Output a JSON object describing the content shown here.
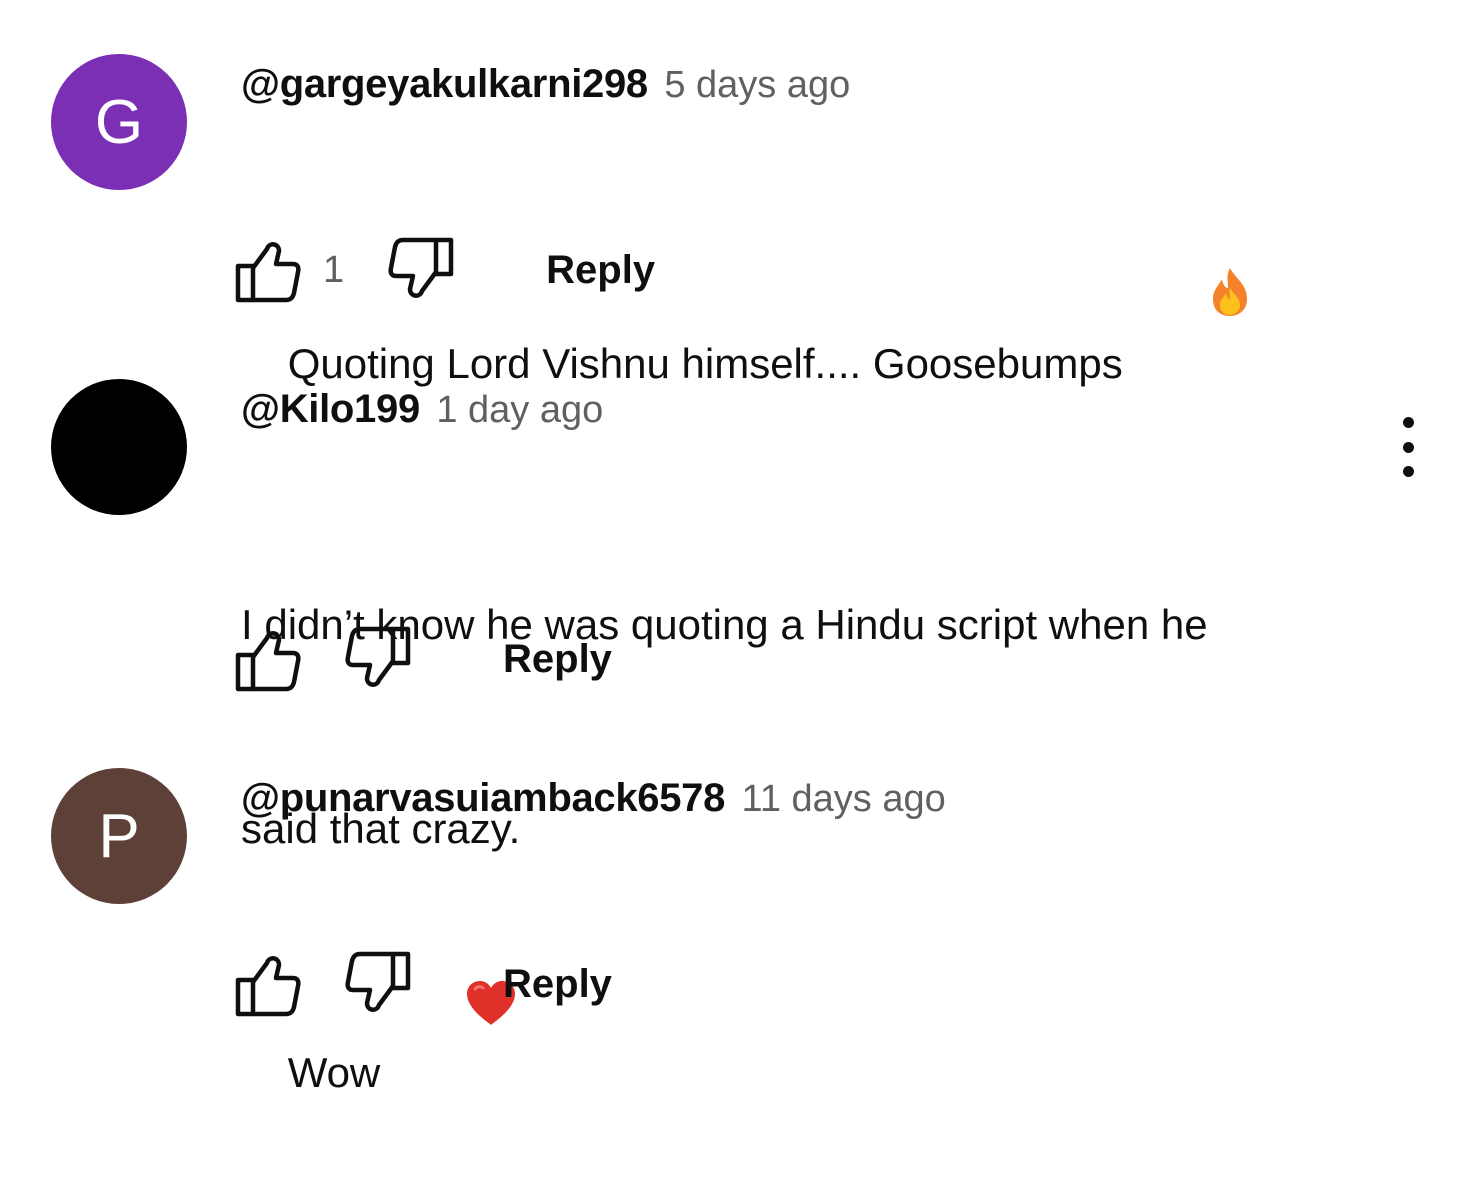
{
  "comments": [
    {
      "avatar_letter": "G",
      "avatar_color": "#7b2fb5",
      "author": "@gargeyakulkarni298",
      "time": "5 days ago",
      "text": "Quoting Lord Vishnu himself.... Goosebumps",
      "emoji": "fire-emoji",
      "likes": "1",
      "reply_label": "Reply"
    },
    {
      "avatar_letter": "",
      "avatar_color": "#000000",
      "author": "@Kilo199",
      "time": "1 day ago",
      "text_lines": [
        "I didn’t know he was quoting a Hindu script when he",
        "said that crazy."
      ],
      "likes": "",
      "reply_label": "Reply"
    },
    {
      "avatar_letter": "P",
      "avatar_color": "#5d4037",
      "author": "@punarvasuiamback6578",
      "time": "11 days ago",
      "text": "Wow",
      "emoji": "red-heart-emoji",
      "likes": "",
      "reply_label": "Reply"
    }
  ],
  "icons": {
    "like": "thumbs-up-icon",
    "dislike": "thumbs-down-icon",
    "menu": "more-vert-icon"
  }
}
